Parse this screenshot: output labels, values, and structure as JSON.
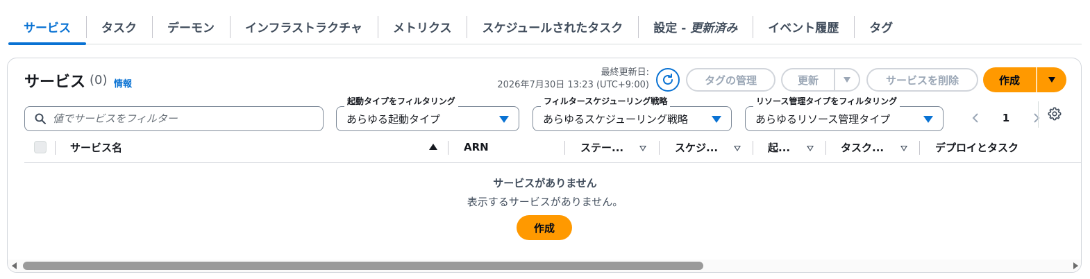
{
  "tabs": [
    {
      "label": "サービス"
    },
    {
      "label": "タスク"
    },
    {
      "label": "デーモン"
    },
    {
      "label": "インフラストラクチャ"
    },
    {
      "label": "メトリクス"
    },
    {
      "label": "スケジュールされたタスク"
    },
    {
      "label": "設定 - ",
      "suffix": "更新済み"
    },
    {
      "label": "イベント履歴"
    },
    {
      "label": "タグ"
    }
  ],
  "active_tab": "サービス",
  "panel": {
    "title": "サービス",
    "count": "(0)",
    "info_link": "情報",
    "last_updated_label": "最終更新日:",
    "last_updated_value": "2026年7月30日 13:23 (UTC+9:00)"
  },
  "actions": {
    "manage_tags": "タグの管理",
    "update": "更新",
    "delete": "サービスを削除",
    "create": "作成"
  },
  "filters": {
    "search_placeholder": "値でサービスをフィルター",
    "launch_type": {
      "label": "起動タイプをフィルタリング",
      "value": "あらゆる起動タイプ"
    },
    "scheduling": {
      "label": "フィルタースケジューリング戦略",
      "value": "あらゆるスケジューリング戦略"
    },
    "resource_type": {
      "label": "リソース管理タイプをフィルタリング",
      "value": "あらゆるリソース管理タイプ"
    }
  },
  "pagination": {
    "current_page": "1"
  },
  "table": {
    "columns": [
      "サービス名",
      "ARN",
      "ステー...",
      "スケジ...",
      "起...",
      "タスク...",
      "デプロイとタスク"
    ]
  },
  "empty_state": {
    "title": "サービスがありません",
    "description": "表示するサービスがありません。",
    "button": "作成"
  },
  "colors": {
    "accent": "#0972d3",
    "primary_button": "#ff9900",
    "disabled_text": "#9ba7b6"
  }
}
